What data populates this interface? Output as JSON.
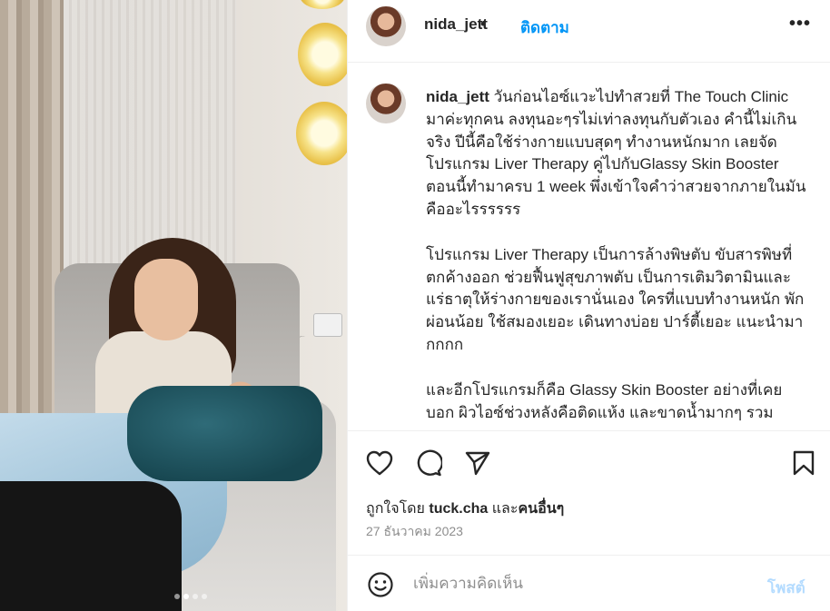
{
  "post": {
    "username": "nida_jett",
    "separator": "•",
    "follow_label": "ติดตาม",
    "more_label": "•••",
    "photo": {
      "carousel_dots": 4,
      "active_dot": 2
    }
  },
  "caption": {
    "username": "nida_jett",
    "paragraphs": [
      "วันก่อนไอซ์แวะไปทำสวยที่ The Touch Clinic มาค่ะทุกคน ลงทุนอะๆรไม่เท่าลงทุนกับตัวเอง คำนี้ไม่เกินจริง ปีนี้คือใช้ร่างกายแบบสุดๆ ทำงานหนักมาก เลยจัดโปรแกรม Liver Therapy คู่ไปกับGlassy Skin Booster ตอนนี้ทำมาครบ 1 week พึ่งเข้าใจคำว่าสวยจากภายในมันคืออะไรรรรรร",
      "โปรแกรม Liver Therapy เป็นการล้างพิษตับ ขับสารพิษที่ตกค้างออก ช่วยฟื้นฟูสุขภาพตับ เป็นการเติมวิตามินและแร่ธาตุให้ร่างกายของเรานั่นเอง ใครที่แบบทำงานหนัก พักผ่อนน้อย ใช้สมองเยอะ เดินทางบ่อย ปาร์ตี้เยอะ แนะนำมากกกก",
      "และอีกโปรแกรมก็คือ Glassy Skin Booster อย่างที่เคยบอก ผิวไอซ์ช่วงหลังคือติดแห้ง และขาดน้ำมากๆ รวม"
    ]
  },
  "actions": {
    "like_icon": "heart-icon",
    "comment_icon": "comment-icon",
    "share_icon": "paper-plane-icon",
    "save_icon": "bookmark-icon"
  },
  "likes": {
    "prefix": "ถูกใจโดย ",
    "liker": "tuck.cha",
    "middle": " และ",
    "others": "คนอื่นๆ"
  },
  "date": "27 ธันวาคม 2023",
  "comment": {
    "emoji_icon": "smiley-icon",
    "placeholder": "เพิ่มความคิดเห็น",
    "value": "",
    "post_label": "โพสต์",
    "post_color": "#b3dbff"
  },
  "colors": {
    "link": "#0095f6",
    "text": "#262626",
    "muted": "#8e8e8e",
    "border": "#efefef"
  }
}
